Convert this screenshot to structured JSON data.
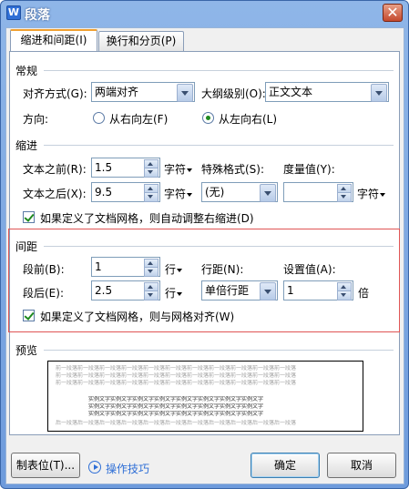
{
  "window": {
    "title": "段落",
    "app_icon": "W",
    "close_glyph": "✕"
  },
  "tabs": [
    {
      "label": "缩进和间距(I)",
      "active": true
    },
    {
      "label": "换行和分页(P)",
      "active": false
    }
  ],
  "general": {
    "section_title": "常规",
    "alignment_label": "对齐方式(G):",
    "alignment_value": "两端对齐",
    "outline_label": "大纲级别(O):",
    "outline_value": "正文文本",
    "direction_label": "方向:",
    "direction_options": [
      {
        "label": "从右向左(F)",
        "selected": false
      },
      {
        "label": "从左向右(L)",
        "selected": true
      }
    ]
  },
  "indent": {
    "section_title": "缩进",
    "before_label": "文本之前(R):",
    "before_value": "1.5",
    "before_unit": "字符",
    "after_label": "文本之后(X):",
    "after_value": "9.5",
    "after_unit": "字符",
    "special_label": "特殊格式(S):",
    "special_value": "(无)",
    "measure_label": "度量值(Y):",
    "measure_value": "",
    "measure_unit": "字符",
    "grid_checkbox_label": "如果定义了文档网格，则自动调整右缩进(D)",
    "grid_checkbox_checked": true
  },
  "spacing": {
    "section_title": "间距",
    "before_label": "段前(B):",
    "before_value": "1",
    "before_unit": "行",
    "after_label": "段后(E):",
    "after_value": "2.5",
    "after_unit": "行",
    "line_spacing_label": "行距(N):",
    "line_spacing_value": "单倍行距",
    "setting_label": "设置值(A):",
    "setting_value": "1",
    "setting_unit": "倍",
    "grid_checkbox_label": "如果定义了文档网格，则与网格对齐(W)",
    "grid_checkbox_checked": true
  },
  "preview": {
    "section_title": "预览",
    "prev_lines": [
      "前一段落前一段落前一段落前一段落前一段落前一段落前一段落前一段落前一段落前一段落前一段落",
      "前一段落前一段落前一段落前一段落前一段落前一段落前一段落前一段落前一段落前一段落前一段落",
      "前一段落前一段落前一段落前一段落前一段落前一段落前一段落前一段落前一段落前一段落前一段落"
    ],
    "sample_lines": [
      "实例文字实例文字实例文字实例文字实例文字实例文字实例文字实例文字",
      "实例文字实例文字实例文字实例文字实例文字实例文字实例文字实例文字",
      "实例文字实例文字实例文字实例文字实例文字实例文字实例文字实例文字"
    ],
    "next_lines": [
      "后一段落后一段落后一段落后一段落后一段落后一段落后一段落后一段落后一段落后一段落后一段落"
    ]
  },
  "footer": {
    "tabs_button": "制表位(T)...",
    "tips_link": "操作技巧",
    "ok_button": "确定",
    "cancel_button": "取消"
  }
}
